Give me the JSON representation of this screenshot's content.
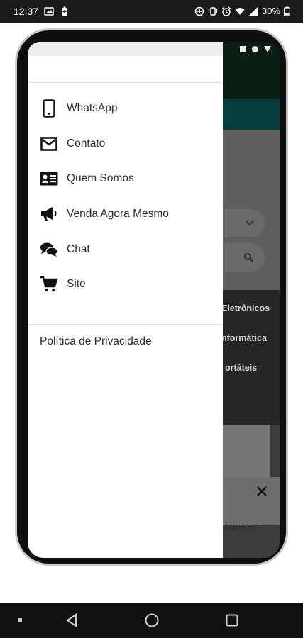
{
  "status_bar": {
    "time": "12:37",
    "battery_percent": "30%"
  },
  "drawer": {
    "items": [
      {
        "label": "WhatsApp",
        "icon": "smartphone-icon"
      },
      {
        "label": "Contato",
        "icon": "envelope-icon"
      },
      {
        "label": "Quem Somos",
        "icon": "id-card-icon"
      },
      {
        "label": "Venda Agora Mesmo",
        "icon": "megaphone-icon"
      },
      {
        "label": "Chat",
        "icon": "chat-bubbles-icon"
      },
      {
        "label": "Site",
        "icon": "shopping-cart-icon"
      }
    ],
    "privacy_label": "Política de Privacidade"
  },
  "background_page": {
    "categories": [
      "Eletrônicos",
      "nformática",
      "ortáteis"
    ],
    "partial_text": "depois em"
  },
  "colors": {
    "status_bar": "#1a1a1a",
    "phone_frame": "#0e0e0e",
    "drawer": "#ffffff",
    "site_header": "#0b1e14",
    "site_teal": "#083f3e",
    "nav_bar": "#111111"
  }
}
